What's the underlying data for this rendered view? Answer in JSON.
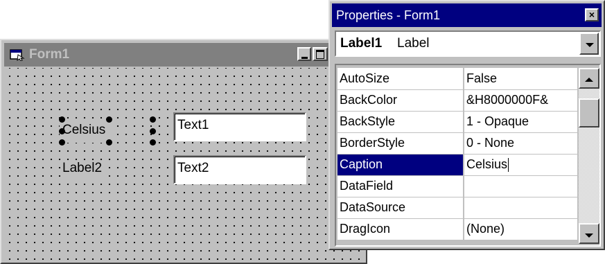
{
  "form_window": {
    "title": "Form1",
    "labels": {
      "label1": "Celsius",
      "label2": "Label2"
    },
    "textboxes": {
      "text1": "Text1",
      "text2": "Text2"
    }
  },
  "properties_window": {
    "title": "Properties - Form1",
    "close_glyph": "×",
    "object": {
      "name": "Label1",
      "type": "Label"
    },
    "rows": [
      {
        "name": "AutoSize",
        "value": "False"
      },
      {
        "name": "BackColor",
        "value": "&H8000000F&"
      },
      {
        "name": "BackStyle",
        "value": "1 - Opaque"
      },
      {
        "name": "BorderStyle",
        "value": "0 - None"
      },
      {
        "name": "Caption",
        "value": "Celsius"
      },
      {
        "name": "DataField",
        "value": ""
      },
      {
        "name": "DataSource",
        "value": ""
      },
      {
        "name": "DragIcon",
        "value": "(None)"
      }
    ],
    "selected_row": "Caption"
  },
  "colors": {
    "active_title": "#000080",
    "inactive_title": "#808080",
    "face": "#c0c0c0",
    "selection": "#000080"
  },
  "icons": [
    "form-icon",
    "minimize-icon",
    "maximize-icon",
    "close-icon",
    "dropdown-arrow-icon",
    "scroll-up-arrow-icon",
    "scroll-down-arrow-icon"
  ]
}
